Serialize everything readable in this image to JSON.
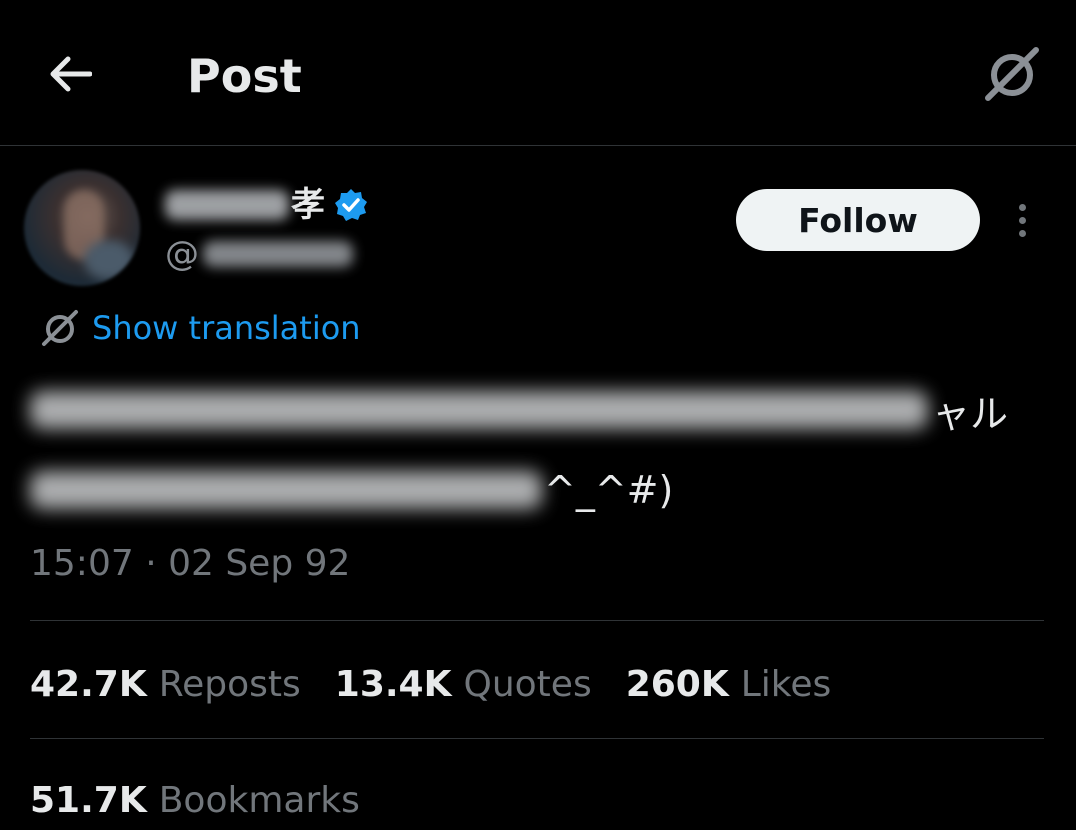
{
  "header": {
    "title": "Post",
    "back_icon": "arrow-left-icon",
    "grok_icon": "grok-icon"
  },
  "author": {
    "name_visible_suffix": "孝",
    "handle_prefix": "@",
    "verified_icon": "verified-badge-icon",
    "verified_color": "#1d9bf0"
  },
  "actions": {
    "follow_label": "Follow",
    "more_icon": "more-vertical-icon"
  },
  "translation": {
    "label": "Show translation",
    "icon": "grok-translate-icon",
    "color": "#1d9bf0"
  },
  "tweet": {
    "line1_visible": "ャル",
    "line2_visible": "^_^#)"
  },
  "meta": {
    "timestamp": "15:07 · 02 Sep 92"
  },
  "stats": {
    "reposts": {
      "value": "42.7K",
      "label": "Reposts"
    },
    "quotes": {
      "value": "13.4K",
      "label": "Quotes"
    },
    "likes": {
      "value": "260K",
      "label": "Likes"
    },
    "bookmarks": {
      "value": "51.7K",
      "label": "Bookmarks"
    }
  },
  "colors": {
    "background": "#000000",
    "text_primary": "#e7e9ea",
    "text_secondary": "#71767b",
    "divider": "#2f3336"
  }
}
